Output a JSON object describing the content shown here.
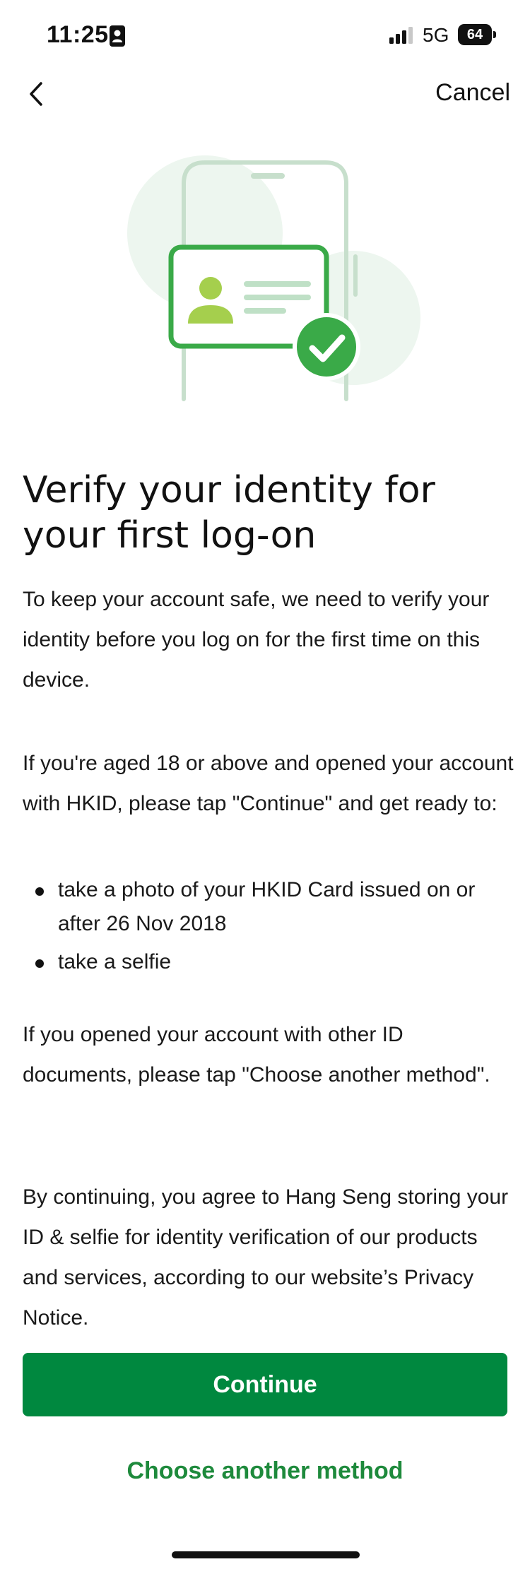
{
  "status_bar": {
    "time": "11:25",
    "network": "5G",
    "battery": "64",
    "icons": [
      "contact-card-icon",
      "signal-bars-icon",
      "battery-icon"
    ]
  },
  "nav": {
    "back_icon": "chevron-left-icon",
    "cancel_label": "Cancel"
  },
  "illustration": {
    "icon": "id-card-verified-illustration",
    "colors": {
      "primary_green": "#3aaa48",
      "light_green": "#e8f4ea",
      "phone_outline": "#c7dfcc",
      "avatar_green": "#a5cf4d"
    }
  },
  "content": {
    "title": "Verify your identity for your first log-on",
    "intro": "To keep your account safe, we need to verify your identity before you log on for the first time on this device.",
    "hkid_text": "If you're aged 18 or above and opened your account with HKID, please tap \"Continue\" and get ready to:",
    "bullets": [
      "take a photo of your HKID Card issued on or after 26 Nov 2018",
      "take a selfie"
    ],
    "other_id_text": "If you opened your account with other ID documents, please tap \"Choose another method\".",
    "consent_text": "By continuing, you agree to Hang Seng storing your ID & selfie for identity verification of our products and services, according to our website’s Privacy Notice."
  },
  "actions": {
    "continue_label": "Continue",
    "alternative_label": "Choose another method"
  },
  "colors": {
    "brand_green": "#00883f",
    "link_green": "#1e8a3c"
  }
}
